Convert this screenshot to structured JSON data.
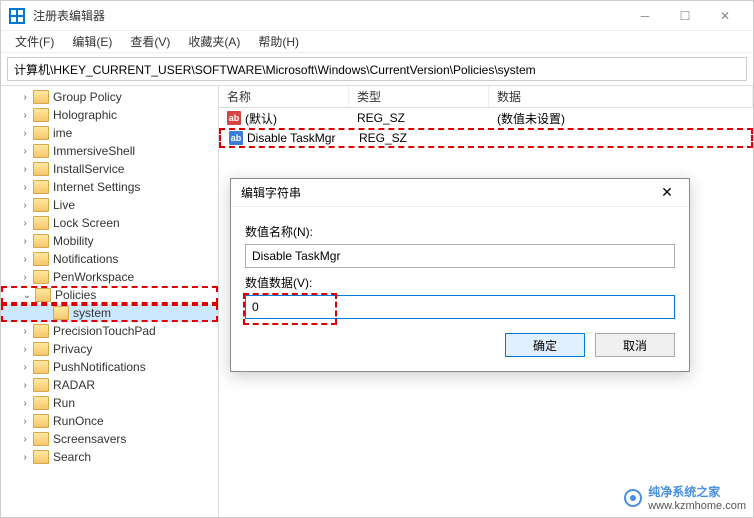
{
  "window": {
    "title": "注册表编辑器"
  },
  "menubar": {
    "file": "文件(F)",
    "edit": "编辑(E)",
    "view": "查看(V)",
    "favorites": "收藏夹(A)",
    "help": "帮助(H)"
  },
  "pathbar": {
    "path": "计算机\\HKEY_CURRENT_USER\\SOFTWARE\\Microsoft\\Windows\\CurrentVersion\\Policies\\system"
  },
  "tree": {
    "items": [
      {
        "label": "Group Policy",
        "expandable": true
      },
      {
        "label": "Holographic",
        "expandable": true
      },
      {
        "label": "ime",
        "expandable": true
      },
      {
        "label": "ImmersiveShell",
        "expandable": true
      },
      {
        "label": "InstallService",
        "expandable": true
      },
      {
        "label": "Internet Settings",
        "expandable": true
      },
      {
        "label": "Live",
        "expandable": true
      },
      {
        "label": "Lock Screen",
        "expandable": true
      },
      {
        "label": "Mobility",
        "expandable": true
      },
      {
        "label": "Notifications",
        "expandable": true
      },
      {
        "label": "PenWorkspace",
        "expandable": true
      },
      {
        "label": "Policies",
        "expandable": true,
        "expanded": true,
        "highlighted": true
      },
      {
        "label": "system",
        "expandable": false,
        "indent": 1,
        "selected": true,
        "highlighted": true
      },
      {
        "label": "PrecisionTouchPad",
        "expandable": true
      },
      {
        "label": "Privacy",
        "expandable": true
      },
      {
        "label": "PushNotifications",
        "expandable": true
      },
      {
        "label": "RADAR",
        "expandable": true
      },
      {
        "label": "Run",
        "expandable": true
      },
      {
        "label": "RunOnce",
        "expandable": true
      },
      {
        "label": "Screensavers",
        "expandable": true
      },
      {
        "label": "Search",
        "expandable": true
      }
    ]
  },
  "list": {
    "col_name": "名称",
    "col_type": "类型",
    "col_data": "数据",
    "rows": [
      {
        "icon": "red",
        "name": "(默认)",
        "type": "REG_SZ",
        "data": "(数值未设置)",
        "highlighted": false
      },
      {
        "icon": "blue",
        "name": "Disable TaskMgr",
        "type": "REG_SZ",
        "data": "",
        "highlighted": true
      }
    ]
  },
  "dialog": {
    "title": "编辑字符串",
    "name_label": "数值名称(N):",
    "name_value": "Disable TaskMgr",
    "data_label": "数值数据(V):",
    "data_value": "0",
    "ok": "确定",
    "cancel": "取消"
  },
  "watermark": {
    "brand": "纯净系统之家",
    "url": "www.kzmhome.com"
  }
}
